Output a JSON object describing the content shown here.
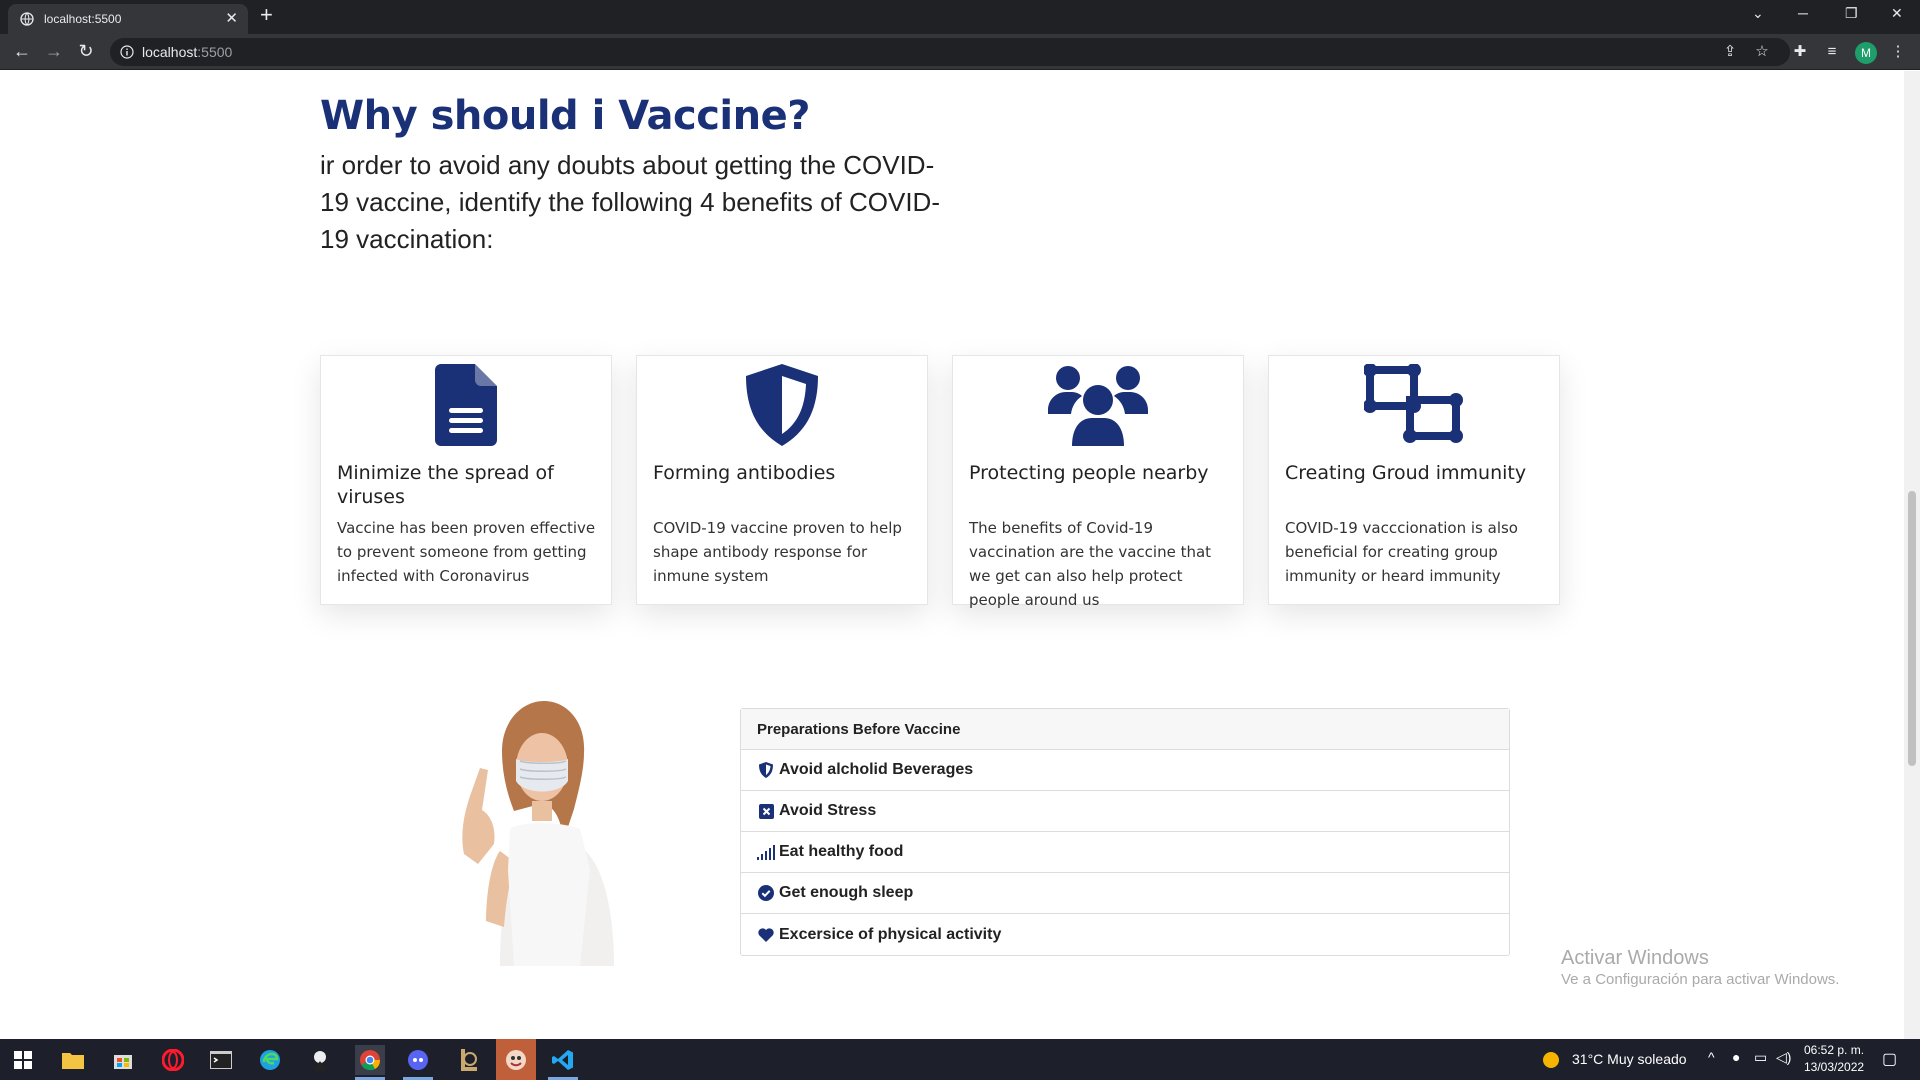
{
  "browser": {
    "tab_title": "localhost:5500",
    "tab_close": "✕",
    "new_tab": "+",
    "url_host": "localhost",
    "url_port": ":5500",
    "minimize": "─",
    "restore": "❐",
    "close": "✕",
    "tab_search": "⌄",
    "profile_initial": "M"
  },
  "page": {
    "heading": "Why should i Vaccine?",
    "intro": "ir order to avoid any doubts about getting the COVID-19 vaccine, identify the following 4 benefits of COVID-19 vaccination:",
    "accent_color": "#1a3178",
    "cards": [
      {
        "icon": "document-icon",
        "title": "Minimize the spread of viruses",
        "text": "Vaccine has been proven effective to prevent someone from getting infected with Coronavirus"
      },
      {
        "icon": "shield-icon",
        "title": "Forming antibodies",
        "text": "COVID-19 vaccine proven to help shape antibody response for inmune system"
      },
      {
        "icon": "users-icon",
        "title": "Protecting people nearby",
        "text": "The benefits of Covid-19 vaccination are the vaccine that we get can also help protect people around us"
      },
      {
        "icon": "network-icon",
        "title": "Creating Groud immunity",
        "text": "COVID-19 vacccionation is also beneficial for creating group immunity or heard immunity"
      }
    ],
    "preparations": {
      "title": "Preparations Before Vaccine",
      "items": [
        {
          "icon": "shield-small-icon",
          "label": "Avoid alcholid Beverages"
        },
        {
          "icon": "x-square-icon",
          "label": "Avoid Stress"
        },
        {
          "icon": "signal-icon",
          "label": "Eat healthy food"
        },
        {
          "icon": "check-circle-icon",
          "label": "Get enough sleep"
        },
        {
          "icon": "heart-icon",
          "label": "Excersice of physical activity"
        }
      ]
    }
  },
  "watermark": {
    "title": "Activar Windows",
    "subtitle": "Ve a Configuración para activar Windows."
  },
  "taskbar": {
    "weather": "31°C  Muy soleado",
    "time": "06:52 p. m.",
    "date": "13/03/2022"
  }
}
